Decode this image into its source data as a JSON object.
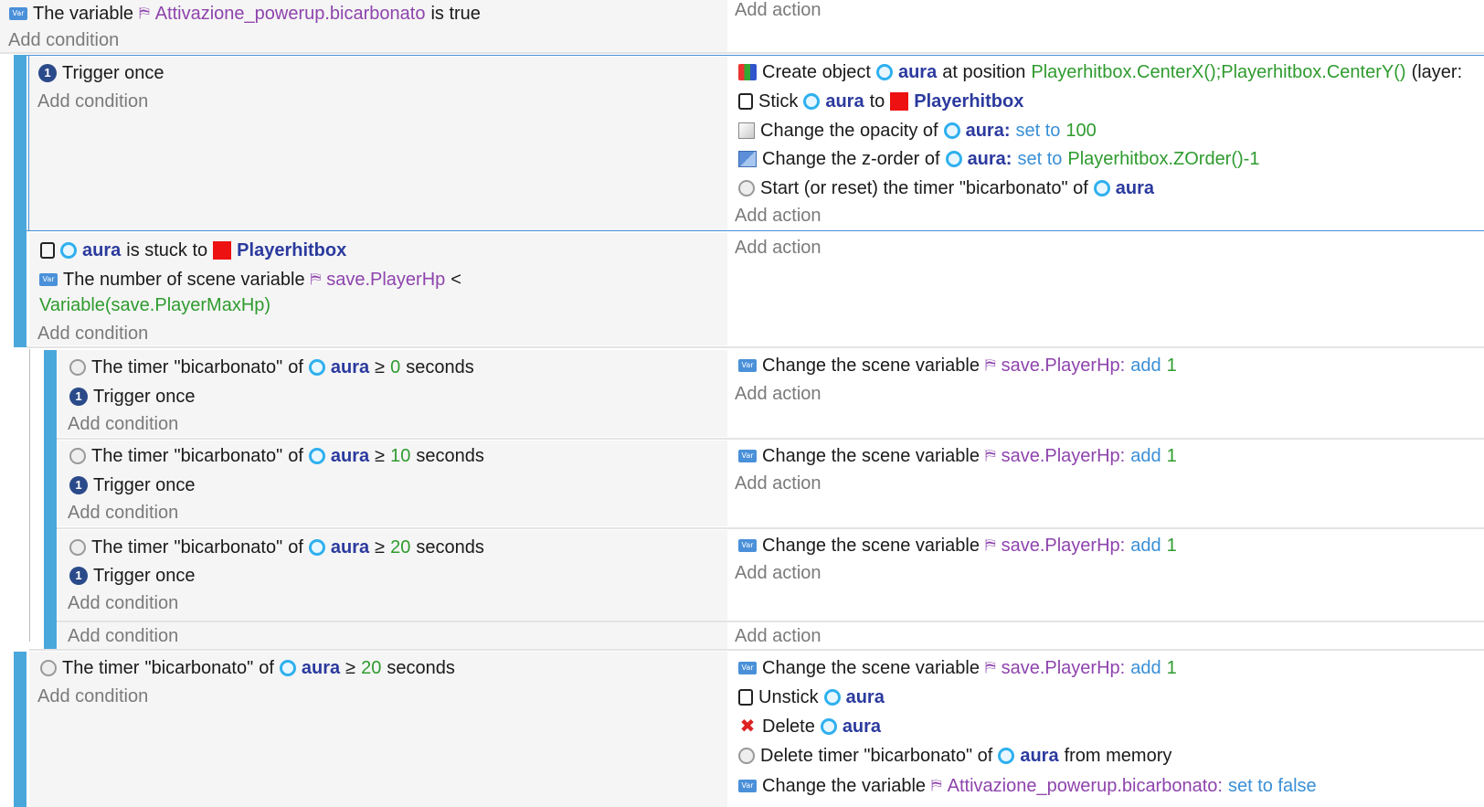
{
  "colors": {
    "accent_bar": "#4aa7dc",
    "object_name": "#2b3a9e",
    "variable_name": "#8e44ad",
    "operation": "#3a8fd6",
    "expression": "#2e9b2e",
    "placeholder": "#7a7a7a"
  },
  "common": {
    "add_condition": "Add condition",
    "add_action": "Add action",
    "trigger_once": "Trigger once",
    "aura": "aura",
    "playerhitbox": "Playerhitbox",
    "of": "of",
    "to": "to",
    "seconds": "seconds",
    "ge": "≥",
    "the_timer": "The timer",
    "bicarbonato_q": "\"bicarbonato\"",
    "change_scene_var": "Change the scene variable",
    "playerhp": "save.PlayerHp",
    "playerhp_colon": "save.PlayerHp:",
    "add_op": "add",
    "one": "1"
  },
  "event0": {
    "cond_text_a": "The variable",
    "cond_var": "Attivazione_powerup.bicarbonato",
    "cond_text_b": "is true"
  },
  "event1": {
    "act1": {
      "a": "Create object",
      "b": "at position",
      "c": "Playerhitbox.CenterX();Playerhitbox.CenterY()",
      "d": "(layer:"
    },
    "act2": {
      "a": "Stick"
    },
    "act3": {
      "a": "Change the opacity of",
      "aura_colon": "aura:",
      "op": "set to",
      "val": "100"
    },
    "act4": {
      "a": "Change the z-order of",
      "aura_colon": "aura:",
      "op": "set to",
      "val": "Playerhitbox.ZOrder()-1"
    },
    "act5": {
      "a": "Start (or reset) the timer \"bicarbonato\" of"
    }
  },
  "event2": {
    "cond1_b": "is stuck to",
    "cond2_a": "The number of scene variable",
    "cond2_lt": "<",
    "cond2_expr": "Variable(save.PlayerMaxHp)"
  },
  "sub_events": [
    {
      "seconds": "0"
    },
    {
      "seconds": "10"
    },
    {
      "seconds": "20"
    }
  ],
  "event3": {
    "seconds": "20",
    "act2": "Unstick",
    "act3": "Delete",
    "act4_a": "Delete timer \"bicarbonato\" of",
    "act4_b": "from memory",
    "act5_a": "Change the variable",
    "act5_var": "Attivazione_powerup.bicarbonato:",
    "act5_op": "set to false"
  }
}
